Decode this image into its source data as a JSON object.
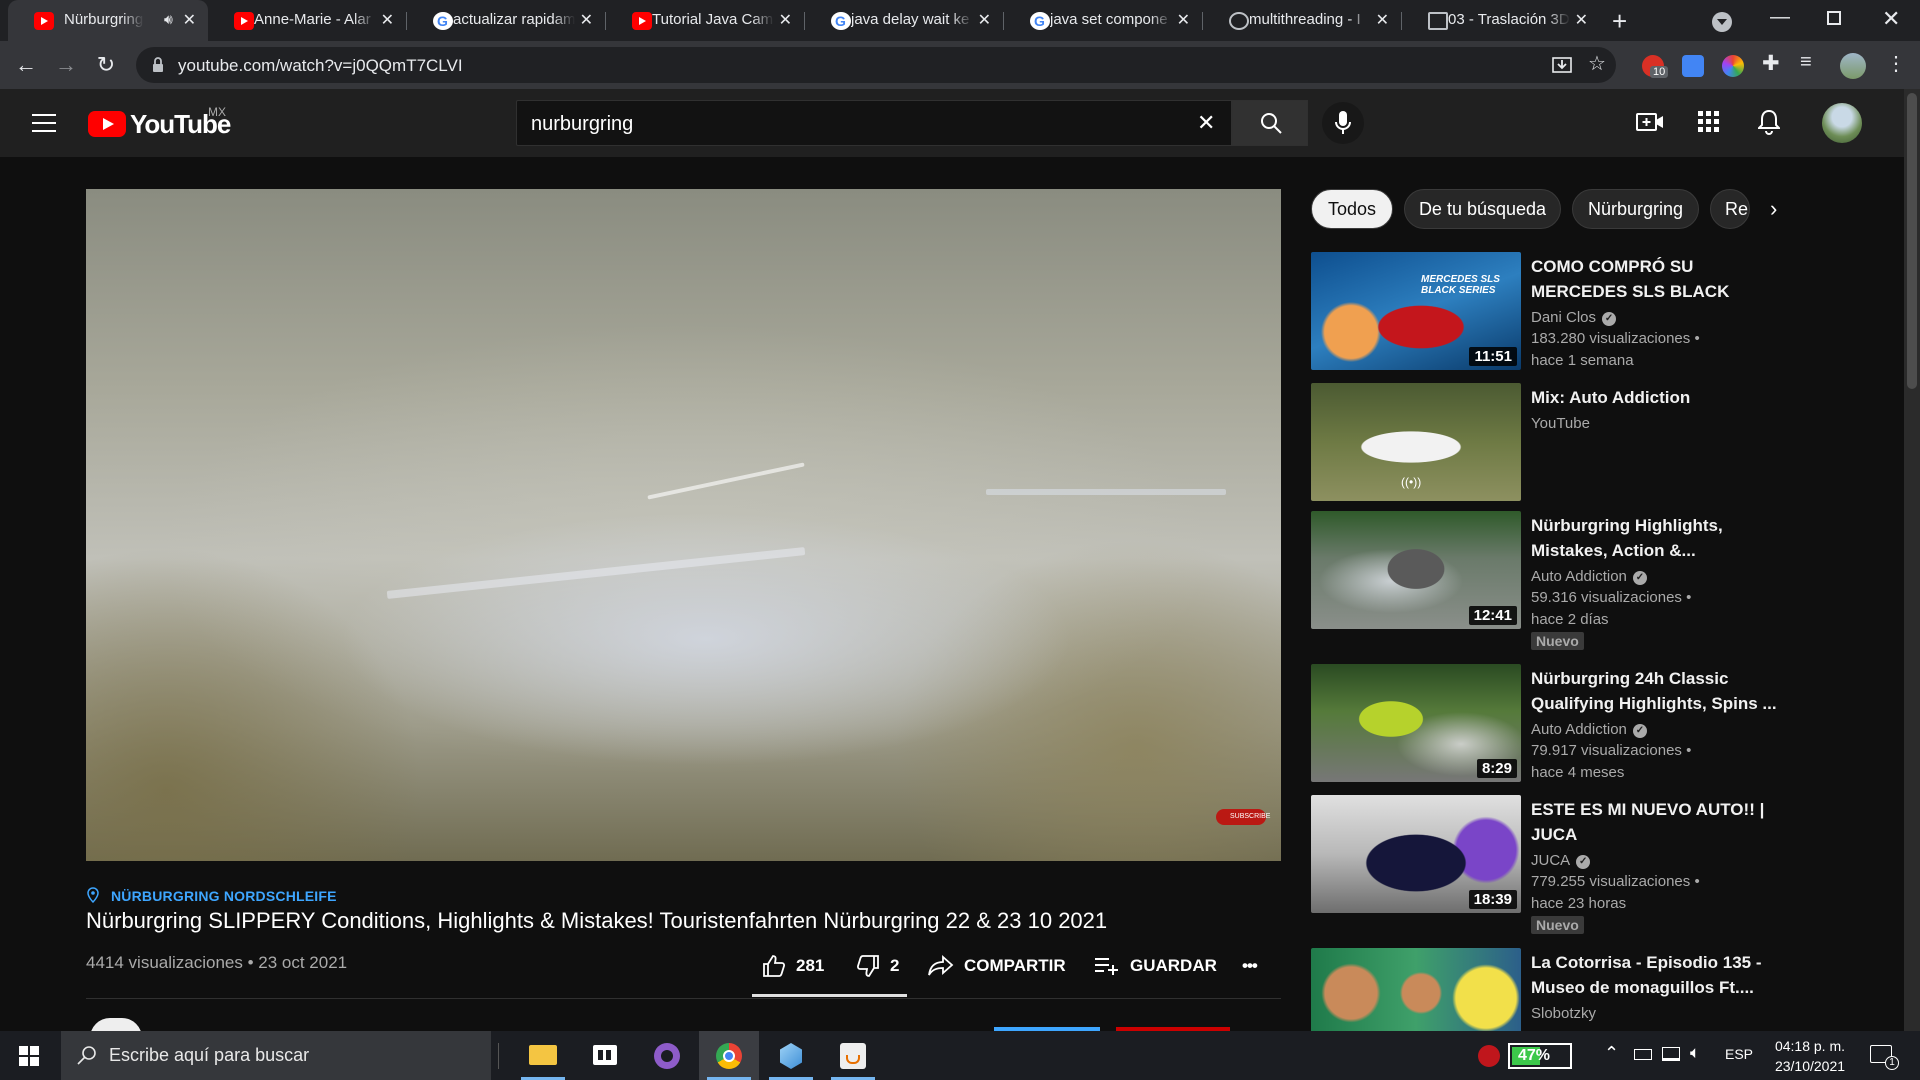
{
  "browser": {
    "tabs": [
      {
        "title": "Nürburgring S",
        "favicon": "youtube-icon",
        "active": true,
        "audio": true
      },
      {
        "title": "Anne-Marie - Alar",
        "favicon": "youtube-icon"
      },
      {
        "title": "actualizar rapidam",
        "favicon": "google-icon"
      },
      {
        "title": "Tutorial Java Cam",
        "favicon": "youtube-icon"
      },
      {
        "title": "java delay wait ke",
        "favicon": "google-icon"
      },
      {
        "title": "java set compone",
        "favicon": "google-icon"
      },
      {
        "title": "multithreading - I",
        "favicon": "globe-icon"
      },
      {
        "title": "03 - Traslación 3D",
        "favicon": "document-icon"
      }
    ],
    "url": "youtube.com/watch?v=j0QQmT7CLVI",
    "extension_badge": "10"
  },
  "youtube": {
    "logo_text": "YouTube",
    "region": "MX",
    "search_value": "nurburgring"
  },
  "video": {
    "location": "NÜRBURGRING NORDSCHLEIFE",
    "title": "Nürburgring SLIPPERY Conditions, Highlights & Mistakes! Touristenfahrten Nürburgring 22 & 23 10 2021",
    "meta": "4414 visualizaciones • 23 oct 2021",
    "likes": "281",
    "dislikes": "2",
    "share_label": "COMPARTIR",
    "save_label": "GUARDAR",
    "more_label": "•••",
    "watermark": "SUBSCRIBE"
  },
  "chips": [
    {
      "label": "Todos",
      "selected": true
    },
    {
      "label": "De tu búsqueda"
    },
    {
      "label": "Nürburgring"
    },
    {
      "label": "Re"
    }
  ],
  "recommendations": [
    {
      "title": "COMO COMPRÓ SU MERCEDES SLS BLACK SERI...",
      "channel": "Dani Clos",
      "verified": true,
      "views": "183.280 visualizaciones •",
      "age": "hace 1 semana",
      "duration": "11:51",
      "badge": "",
      "thumb_text": "MERCEDES SLS BLACK SERIES"
    },
    {
      "title": "Mix: Auto Addiction",
      "channel": "YouTube",
      "verified": false,
      "views": "",
      "age": "",
      "duration": "",
      "badge": "",
      "live_icon": "((•))"
    },
    {
      "title": "Nürburgring Highlights, Mistakes, Action &...",
      "channel": "Auto Addiction",
      "verified": true,
      "views": "59.316 visualizaciones •",
      "age": "hace 2 días",
      "duration": "12:41",
      "badge": "Nuevo"
    },
    {
      "title": "Nürburgring 24h Classic Qualifying Highlights, Spins ...",
      "channel": "Auto Addiction",
      "verified": true,
      "views": "79.917 visualizaciones •",
      "age": "hace 4 meses",
      "duration": "8:29",
      "badge": ""
    },
    {
      "title": "ESTE ES MI NUEVO AUTO!! | JUCA",
      "channel": "JUCA",
      "verified": true,
      "views": "779.255 visualizaciones •",
      "age": "hace 23 horas",
      "duration": "18:39",
      "badge": "Nuevo"
    },
    {
      "title": "La Cotorrisa - Episodio 135 - Museo de monaguillos Ft....",
      "channel": "Slobotzky",
      "verified": false,
      "views": "",
      "age": "",
      "duration": "",
      "badge": ""
    }
  ],
  "taskbar": {
    "search_placeholder": "Escribe aquí para buscar",
    "battery": "47%",
    "language": "ESP",
    "time": "04:18 p. m.",
    "date": "23/10/2021",
    "notifications": "1"
  },
  "colors": {
    "youtube_red": "#ff0000",
    "link_blue": "#3ea6ff",
    "background": "#0f0f0f",
    "header": "#202020"
  }
}
